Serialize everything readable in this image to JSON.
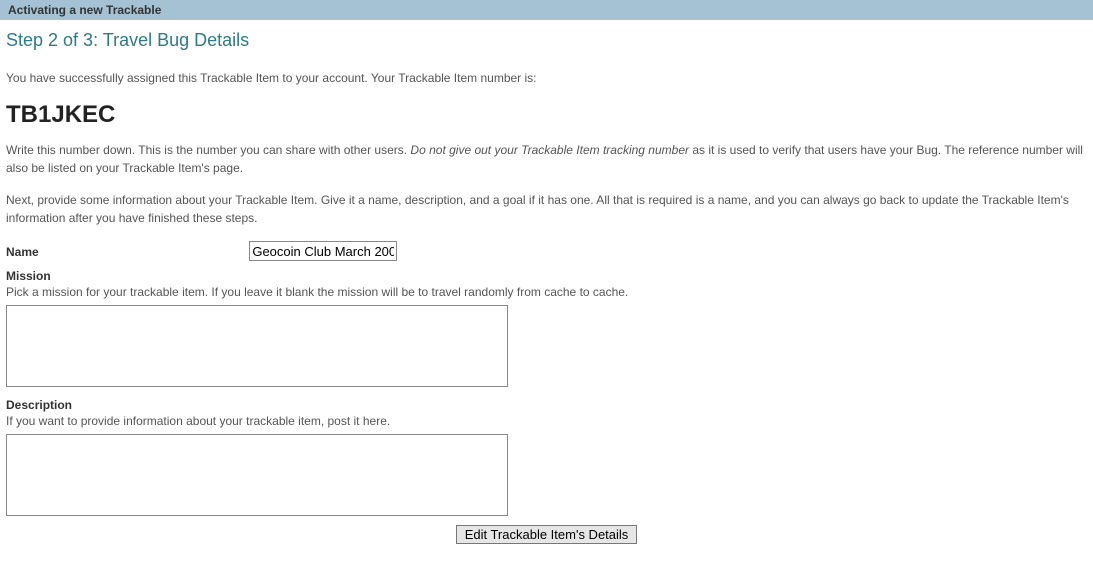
{
  "header": {
    "title": "Activating a new Trackable"
  },
  "step": {
    "title": "Step 2 of 3: Travel Bug Details"
  },
  "intro": {
    "success_line": "You have successfully assigned this Trackable Item to your account. Your Trackable Item number is:",
    "trackable_number": "TB1JKEC",
    "writedown_pre": "Write this number down. This is the number you can share with other users. ",
    "writedown_italic": "Do not give out your Trackable Item tracking number",
    "writedown_post": " as it is used to verify that users have your Bug. The reference number will also be listed on your Trackable Item's page.",
    "next_para": "Next, provide some information about your Trackable Item. Give it a name, description, and a goal if it has one. All that is required is a name, and you can always go back to update the Trackable Item's information after you have finished these steps."
  },
  "form": {
    "name": {
      "label": "Name",
      "value": "Geocoin Club March 200"
    },
    "mission": {
      "label": "Mission",
      "hint": "Pick a mission for your trackable item. If you leave it blank the mission will be to travel randomly from cache to cache.",
      "value": ""
    },
    "description": {
      "label": "Description",
      "hint": "If you want to provide information about your trackable item, post it here.",
      "value": ""
    },
    "submit_label": "Edit Trackable Item's Details"
  }
}
